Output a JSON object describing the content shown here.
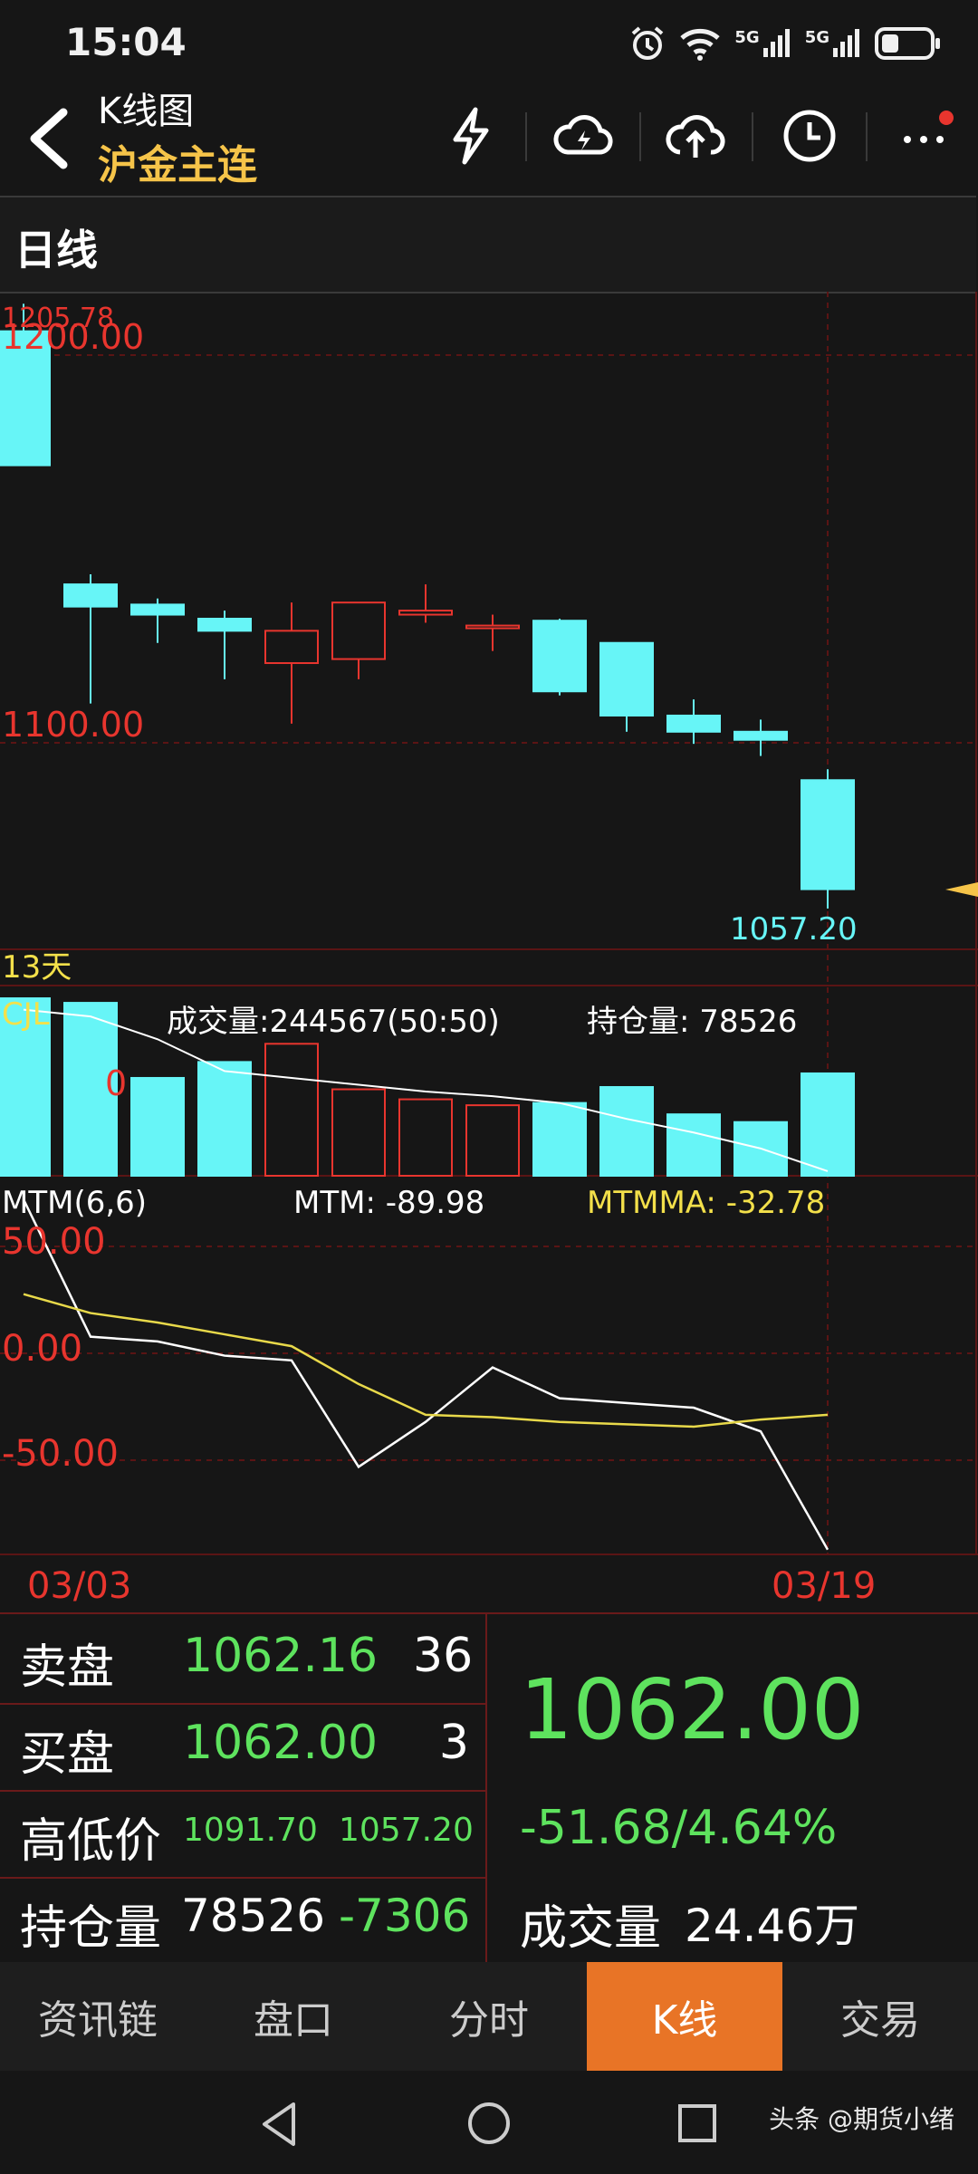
{
  "status_bar": {
    "time": "15:04",
    "signal_1": "5G",
    "signal_2": "5G"
  },
  "header": {
    "title": "K线图",
    "subtitle": "沪金主连",
    "icons": [
      "back-arrow-icon",
      "lightning-icon",
      "cloud-lightning-icon",
      "cloud-upload-icon",
      "clock-icon",
      "more-icon"
    ]
  },
  "period": {
    "label": "日线"
  },
  "price_chart": {
    "labels": {
      "max_price": "1205.78",
      "top_grid": "1200.00",
      "mid_grid": "1100.00",
      "min_price": "1057.20",
      "days": "13天"
    },
    "y_range": [
      1048,
      1210
    ],
    "candles": [
      {
        "o": 1200.2,
        "h": 1207,
        "l": 1170,
        "c": 1167,
        "dir": "down"
      },
      {
        "o": 1137.5,
        "h": 1140,
        "l": 1108,
        "c": 1132,
        "dir": "down"
      },
      {
        "o": 1132.5,
        "h": 1134,
        "l": 1123,
        "c": 1130,
        "dir": "down"
      },
      {
        "o": 1129,
        "h": 1131,
        "l": 1114,
        "c": 1126,
        "dir": "down"
      },
      {
        "o": 1118,
        "h": 1133,
        "l": 1103,
        "c": 1126,
        "dir": "up"
      },
      {
        "o": 1119,
        "h": 1132,
        "l": 1114,
        "c": 1133,
        "dir": "up"
      },
      {
        "o": 1130,
        "h": 1137.5,
        "l": 1128,
        "c": 1131,
        "dir": "up"
      },
      {
        "o": 1127,
        "h": 1130,
        "l": 1121,
        "c": 1127.3,
        "dir": "up"
      },
      {
        "o": 1128.5,
        "h": 1129,
        "l": 1110,
        "c": 1111,
        "dir": "down"
      },
      {
        "o": 1123,
        "h": 1123,
        "l": 1101,
        "c": 1105,
        "dir": "down"
      },
      {
        "o": 1105,
        "h": 1109,
        "l": 1098,
        "c": 1101,
        "dir": "down"
      },
      {
        "o": 1101,
        "h": 1104,
        "l": 1095,
        "c": 1099,
        "dir": "down"
      },
      {
        "o": 1089,
        "h": 1091.7,
        "l": 1057.2,
        "c": 1062,
        "dir": "down"
      }
    ]
  },
  "volume_chart": {
    "label": "CJL",
    "volume_text": "成交量:244567(50:50)",
    "oi_text": "持仓量: 78526",
    "ghost_label": "0",
    "y_range": [
      0,
      410000
    ],
    "volumes": [
      390000,
      380000,
      215000,
      250000,
      290000,
      190000,
      168000,
      155000,
      160000,
      195000,
      135000,
      118000,
      225000
    ],
    "oi_line": [
      365000,
      350000,
      300000,
      230000,
      215000,
      200000,
      185000,
      175000,
      160000,
      125000,
      95000,
      60000,
      10000
    ]
  },
  "mtm_chart": {
    "label": "MTM(6,6)",
    "mtm_text": "MTM: -89.98",
    "mtmma_text": "MTMMA: -32.78",
    "axis_labels": [
      "50.00",
      "0.00",
      "-50.00"
    ],
    "y_range": [
      -92,
      55
    ],
    "mtm": [
      58,
      0,
      -2,
      -8,
      -10,
      -55,
      -36,
      -13,
      -26,
      -28,
      -30,
      -40,
      -90
    ],
    "mtmma": [
      18,
      10,
      6,
      1,
      -4,
      -20,
      -33,
      -34,
      -36,
      -37,
      -38,
      -35,
      -33
    ],
    "x_labels": [
      "03/03",
      "03/19"
    ]
  },
  "quote": {
    "ask_label": "卖盘",
    "ask_price": "1062.16",
    "ask_vol": "36",
    "bid_label": "买盘",
    "bid_price": "1062.00",
    "bid_vol": "3",
    "hl_label": "高低价",
    "high": "1091.70",
    "low": "1057.20",
    "oi_label": "持仓量",
    "oi": "78526",
    "oi_change": "-7306",
    "last_price": "1062.00",
    "change": "-51.68/4.64%",
    "turnover_label": "成交量",
    "turnover": "24.46万"
  },
  "tabs": [
    {
      "label": "资讯链",
      "active": false
    },
    {
      "label": "盘口",
      "active": false
    },
    {
      "label": "分时",
      "active": false
    },
    {
      "label": "K线",
      "active": true
    },
    {
      "label": "交易",
      "active": false
    }
  ],
  "watermark": "头条 @期货小绪",
  "colors": {
    "up": "#e8352e",
    "down": "#67f5f7",
    "accent": "#e87426",
    "gold": "#f6c449",
    "green": "#5ee35e"
  }
}
